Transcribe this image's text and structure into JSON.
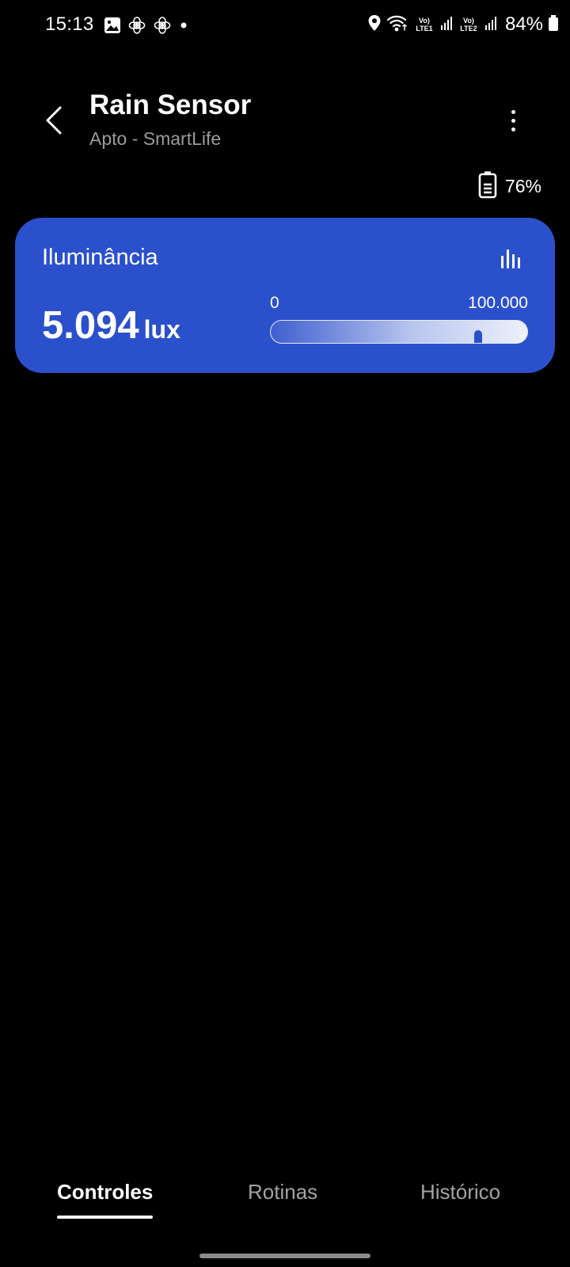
{
  "status_bar": {
    "time": "15:13",
    "lte1": "Vo) LTE1",
    "lte2": "Vo) LTE2",
    "battery": "84%"
  },
  "header": {
    "title": "Rain Sensor",
    "subtitle": "Apto - SmartLife"
  },
  "device_battery": "76%",
  "card": {
    "label": "Iluminância",
    "value": "5.094",
    "unit": "lux",
    "range_min": "0",
    "range_max": "100.000",
    "level_fraction": 0.82,
    "color": "#2a50cc"
  },
  "tabs": {
    "controles": "Controles",
    "rotinas": "Rotinas",
    "historico": "Histórico"
  }
}
